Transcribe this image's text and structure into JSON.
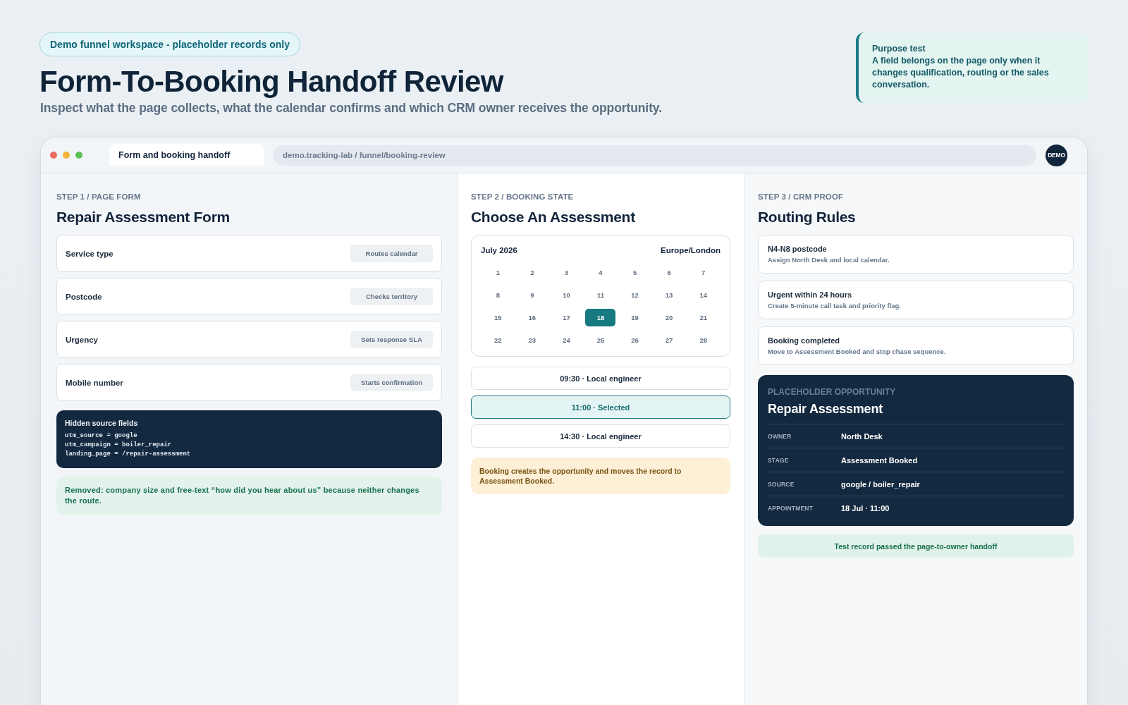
{
  "badge": "Demo funnel workspace - placeholder records only",
  "title": "Form-To-Booking Handoff Review",
  "subtitle": "Inspect what the page collects, what the calendar confirms and which CRM owner receives the opportunity.",
  "callout": {
    "title": "Purpose test",
    "text": "A field belongs on the page only when it changes qualification, routing or the sales conversation."
  },
  "browser": {
    "tab": "Form and booking handoff",
    "url": "demo.tracking-lab / funnel/booking-review",
    "avatar": "DEMO"
  },
  "form_panel": {
    "step": "STEP 1 / PAGE FORM",
    "heading": "Repair Assessment Form",
    "fields": [
      {
        "label": "Service type",
        "tag": "Routes calendar"
      },
      {
        "label": "Postcode",
        "tag": "Checks territory"
      },
      {
        "label": "Urgency",
        "tag": "Sets response SLA"
      },
      {
        "label": "Mobile number",
        "tag": "Starts confirmation"
      }
    ],
    "hidden_fields": {
      "title": "Hidden source fields",
      "lines": [
        "utm_source = google",
        "utm_campaign = boiler_repair",
        "landing_page = /repair-assessment"
      ]
    },
    "note": "Removed: company size and free-text “how did you hear about us” because neither changes the route."
  },
  "booking_panel": {
    "step": "STEP 2 / BOOKING STATE",
    "heading": "Choose An Assessment",
    "calendar": {
      "month": "July 2026",
      "timezone": "Europe/London",
      "days": [
        {
          "label": "1",
          "selected": false
        },
        {
          "label": "2",
          "selected": false
        },
        {
          "label": "3",
          "selected": false
        },
        {
          "label": "4",
          "selected": false
        },
        {
          "label": "5",
          "selected": false
        },
        {
          "label": "6",
          "selected": false
        },
        {
          "label": "7",
          "selected": false
        },
        {
          "label": "8",
          "selected": false
        },
        {
          "label": "9",
          "selected": false
        },
        {
          "label": "10",
          "selected": false
        },
        {
          "label": "11",
          "selected": false
        },
        {
          "label": "12",
          "selected": false
        },
        {
          "label": "13",
          "selected": false
        },
        {
          "label": "14",
          "selected": false
        },
        {
          "label": "15",
          "selected": false
        },
        {
          "label": "16",
          "selected": false
        },
        {
          "label": "17",
          "selected": false
        },
        {
          "label": "18",
          "selected": true
        },
        {
          "label": "19",
          "selected": false
        },
        {
          "label": "20",
          "selected": false
        },
        {
          "label": "21",
          "selected": false
        },
        {
          "label": "22",
          "selected": false
        },
        {
          "label": "23",
          "selected": false
        },
        {
          "label": "24",
          "selected": false
        },
        {
          "label": "25",
          "selected": false
        },
        {
          "label": "26",
          "selected": false
        },
        {
          "label": "27",
          "selected": false
        },
        {
          "label": "28",
          "selected": false
        }
      ]
    },
    "slots": [
      {
        "label": "09:30 · Local engineer",
        "selected": false
      },
      {
        "label": "11:00 · Selected",
        "selected": true
      },
      {
        "label": "14:30 · Local engineer",
        "selected": false
      }
    ],
    "note": "Booking creates the opportunity and moves the record to Assessment Booked."
  },
  "crm_panel": {
    "step": "STEP 3 / CRM PROOF",
    "heading": "Routing Rules",
    "rules": [
      {
        "title": "N4-N8 postcode",
        "text": "Assign North Desk and local calendar."
      },
      {
        "title": "Urgent within 24 hours",
        "text": "Create 5-minute call task and priority flag."
      },
      {
        "title": "Booking completed",
        "text": "Move to Assessment Booked and stop chase sequence."
      }
    ],
    "opportunity": {
      "eyebrow": "PLACEHOLDER OPPORTUNITY",
      "title": "Repair Assessment",
      "rows": [
        {
          "label": "OWNER",
          "value": "North Desk"
        },
        {
          "label": "STAGE",
          "value": "Assessment Booked"
        },
        {
          "label": "SOURCE",
          "value": "google / boiler_repair"
        },
        {
          "label": "APPOINTMENT",
          "value": "18 Jul · 11:00"
        }
      ]
    },
    "status": "Test record passed the page-to-owner handoff"
  }
}
